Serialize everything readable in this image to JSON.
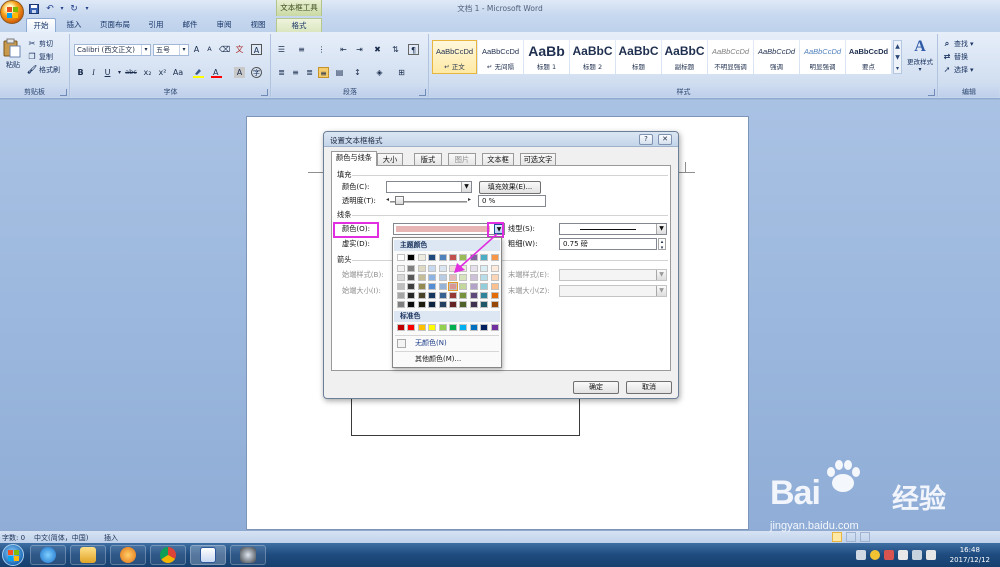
{
  "window": {
    "title": "文档 1 - Microsoft Word",
    "context_tab_title": "文本框工具"
  },
  "tabs": [
    {
      "label": "开始",
      "active": true
    },
    {
      "label": "插入"
    },
    {
      "label": "页面布局"
    },
    {
      "label": "引用"
    },
    {
      "label": "邮件"
    },
    {
      "label": "审阅"
    },
    {
      "label": "视图"
    },
    {
      "label": "格式",
      "context": true
    }
  ],
  "ribbon": {
    "clipboard": {
      "label": "剪贴板",
      "paste": "粘贴",
      "cut": "剪切",
      "copy": "复制",
      "format_painter": "格式刷"
    },
    "font": {
      "label": "字体",
      "font_name": "Calibri (西文正文)",
      "font_size": "五号",
      "bold": "B",
      "italic": "I",
      "underline": "U",
      "strike": "abc",
      "subscript": "x₂",
      "superscript": "x²",
      "case": "Aa",
      "grow": "A",
      "shrink": "A"
    },
    "paragraph": {
      "label": "段落"
    },
    "styles": {
      "label": "样式",
      "cards": [
        {
          "preview": "AaBbCcDd",
          "name": "↵ 正文",
          "active": true
        },
        {
          "preview": "AaBbCcDd",
          "name": "↵ 无间隔"
        },
        {
          "preview": "AaBb",
          "name": "标题 1"
        },
        {
          "preview": "AaBbC",
          "name": "标题 2"
        },
        {
          "preview": "AaBbC",
          "name": "标题"
        },
        {
          "preview": "AaBbC",
          "name": "副标题"
        },
        {
          "preview": "AaBbCcDd",
          "name": "不明显强调"
        },
        {
          "preview": "AaBbCcDd",
          "name": "强调"
        },
        {
          "preview": "AaBbCcDd",
          "name": "明显强调"
        },
        {
          "preview": "AaBbCcDd",
          "name": "要点"
        }
      ],
      "change_styles": "更改样式"
    },
    "editing": {
      "label": "编辑",
      "find": "查找",
      "replace": "替换",
      "select": "选择"
    }
  },
  "dialog": {
    "title": "设置文本框格式",
    "help": "?",
    "close": "✕",
    "tabs": [
      {
        "label": "颜色与线条",
        "active": true
      },
      {
        "label": "大小"
      },
      {
        "label": "版式"
      },
      {
        "label": "图片",
        "disabled": true
      },
      {
        "label": "文本框"
      },
      {
        "label": "可选文字"
      }
    ],
    "fill": {
      "section": "填充",
      "color_label": "颜色(C):",
      "fill_effects": "填充效果(E)...",
      "transparency_label": "透明度(T):",
      "transparency_value": "0 %"
    },
    "line": {
      "section": "线条",
      "color_label": "颜色(O):",
      "color_value": "#e8b5b5",
      "dash_label": "虚实(D):",
      "style_label": "线型(S):",
      "weight_label": "粗细(W):",
      "weight_value": "0.75 磅"
    },
    "arrows": {
      "section": "箭头",
      "begin_style": "始端样式(B):",
      "begin_size": "始端大小(I):",
      "end_style": "末端样式(E):",
      "end_size": "末端大小(Z):"
    },
    "ok": "确定",
    "cancel": "取消"
  },
  "color_popup": {
    "theme_header": "主题颜色",
    "standard_header": "标准色",
    "no_color": "无颜色(N)",
    "more_colors": "其他颜色(M)...",
    "theme_top": [
      "#ffffff",
      "#000000",
      "#eeece1",
      "#1f497d",
      "#4f81bd",
      "#c0504d",
      "#9bbb59",
      "#8064a2",
      "#4bacc6",
      "#f79646"
    ],
    "theme_shades": [
      [
        "#f2f2f2",
        "#808080",
        "#ddd9c3",
        "#c6d9f0",
        "#dbe5f1",
        "#f2dcdb",
        "#ebf1dd",
        "#e5e0ec",
        "#dbeef3",
        "#fdeada"
      ],
      [
        "#d8d8d8",
        "#595959",
        "#c4bd97",
        "#8db3e2",
        "#b8cce4",
        "#e5b9b7",
        "#d7e3bc",
        "#ccc1d9",
        "#b7dde8",
        "#fbd5b5"
      ],
      [
        "#bfbfbf",
        "#3f3f3f",
        "#938953",
        "#548dd4",
        "#95b3d7",
        "#d99694",
        "#c3d69b",
        "#b2a2c7",
        "#92cddc",
        "#fac08f"
      ],
      [
        "#a5a5a5",
        "#262626",
        "#494429",
        "#17365d",
        "#366092",
        "#953734",
        "#76923c",
        "#5f497a",
        "#31859b",
        "#e36c09"
      ],
      [
        "#7f7f7f",
        "#0c0c0c",
        "#1d1b10",
        "#0f243e",
        "#244061",
        "#632423",
        "#4f6128",
        "#3f3151",
        "#205867",
        "#974806"
      ]
    ],
    "standard": [
      "#c00000",
      "#ff0000",
      "#ffc000",
      "#ffff00",
      "#92d050",
      "#00b050",
      "#00b0f0",
      "#0070c0",
      "#002060",
      "#7030a0"
    ]
  },
  "statusbar": {
    "word_count": "字数: 0",
    "language": "中文(简体，中国)",
    "mode": "插入"
  },
  "taskbar": {
    "time": "16:48",
    "date": "2017/12/12"
  },
  "watermark": {
    "brand": "Bai",
    "brand_cn": "经验",
    "url": "jingyan.baidu.com"
  },
  "colors": {
    "highlight": "#e02ee0",
    "selected_line_color": "#e8b5b5"
  }
}
